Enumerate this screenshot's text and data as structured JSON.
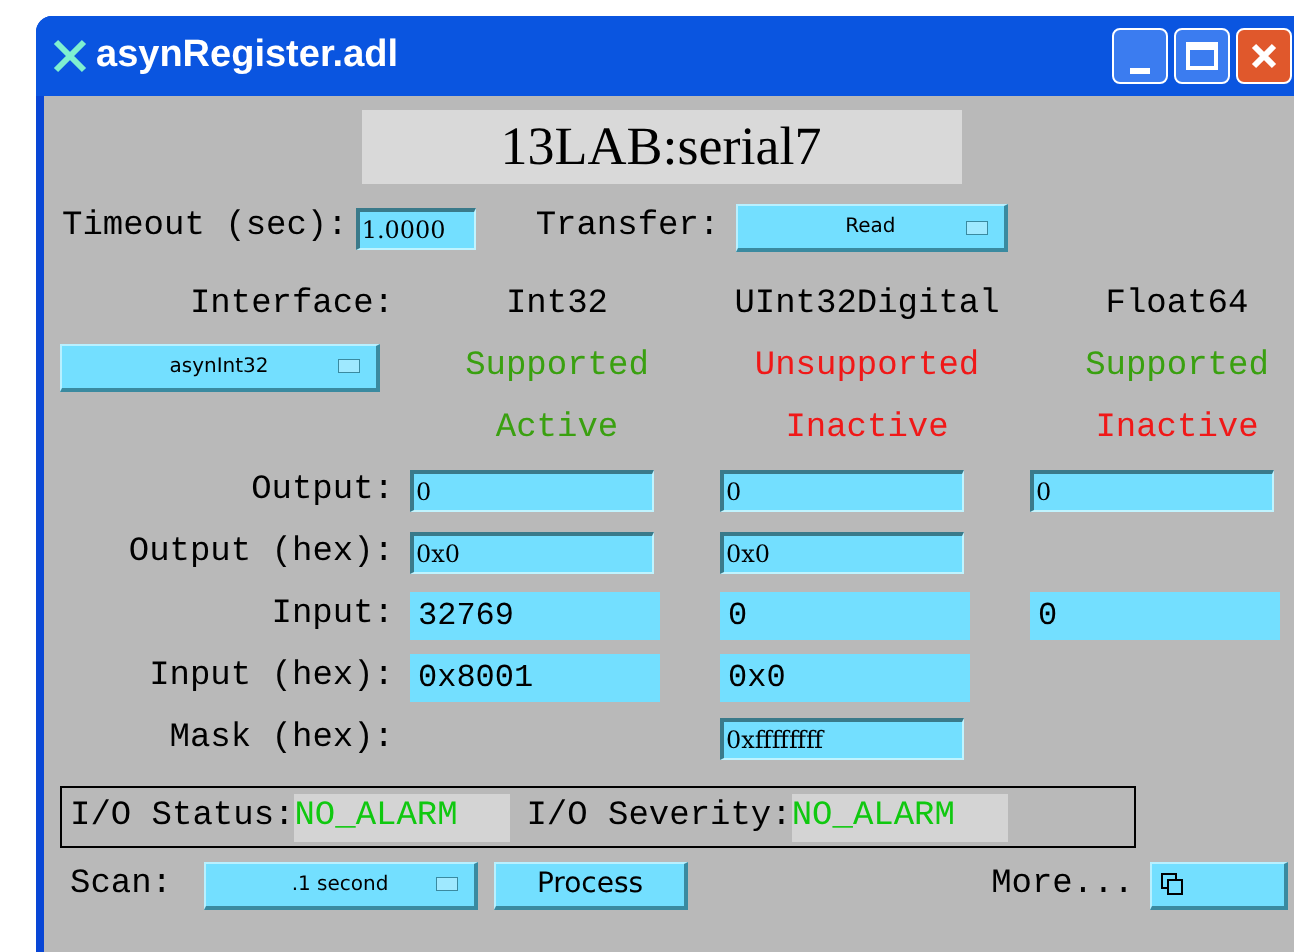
{
  "window": {
    "title": "asynRegister.adl"
  },
  "device": "13LAB:serial7",
  "timeout": {
    "label": "Timeout (sec):",
    "value": "1.0000"
  },
  "transfer": {
    "label": "Transfer:",
    "value": "Read"
  },
  "interface": {
    "label": "Interface:",
    "value": "asynInt32"
  },
  "columns": [
    {
      "name": "Int32",
      "support": "Supported",
      "supported": true,
      "state": "Active",
      "active": true
    },
    {
      "name": "UInt32Digital",
      "support": "Unsupported",
      "supported": false,
      "state": "Inactive",
      "active": false
    },
    {
      "name": "Float64",
      "support": "Supported",
      "supported": true,
      "state": "Inactive",
      "active": false
    }
  ],
  "rows": [
    {
      "label": "Output:",
      "cells": [
        {
          "kind": "field",
          "value": "0"
        },
        {
          "kind": "field",
          "value": "0"
        },
        {
          "kind": "field",
          "value": "0"
        }
      ]
    },
    {
      "label": "Output (hex):",
      "cells": [
        {
          "kind": "field",
          "value": "0x0"
        },
        {
          "kind": "field",
          "value": "0x0"
        },
        {
          "kind": "blank"
        }
      ]
    },
    {
      "label": "Input:",
      "cells": [
        {
          "kind": "readout",
          "value": "32769"
        },
        {
          "kind": "readout",
          "value": "0"
        },
        {
          "kind": "readout",
          "value": "0"
        }
      ]
    },
    {
      "label": "Input (hex):",
      "cells": [
        {
          "kind": "readout",
          "value": "0x8001"
        },
        {
          "kind": "readout",
          "value": "0x0"
        },
        {
          "kind": "blank"
        }
      ]
    },
    {
      "label": "Mask (hex):",
      "cells": [
        {
          "kind": "blank"
        },
        {
          "kind": "field",
          "value": "0xffffffff"
        },
        {
          "kind": "blank"
        }
      ]
    }
  ],
  "status": {
    "label": "I/O Status:",
    "value": "NO_ALARM"
  },
  "severity": {
    "label": "I/O Severity:",
    "value": "NO_ALARM"
  },
  "scan": {
    "label": "Scan:",
    "value": ".1 second"
  },
  "process": "Process",
  "more": "More..."
}
